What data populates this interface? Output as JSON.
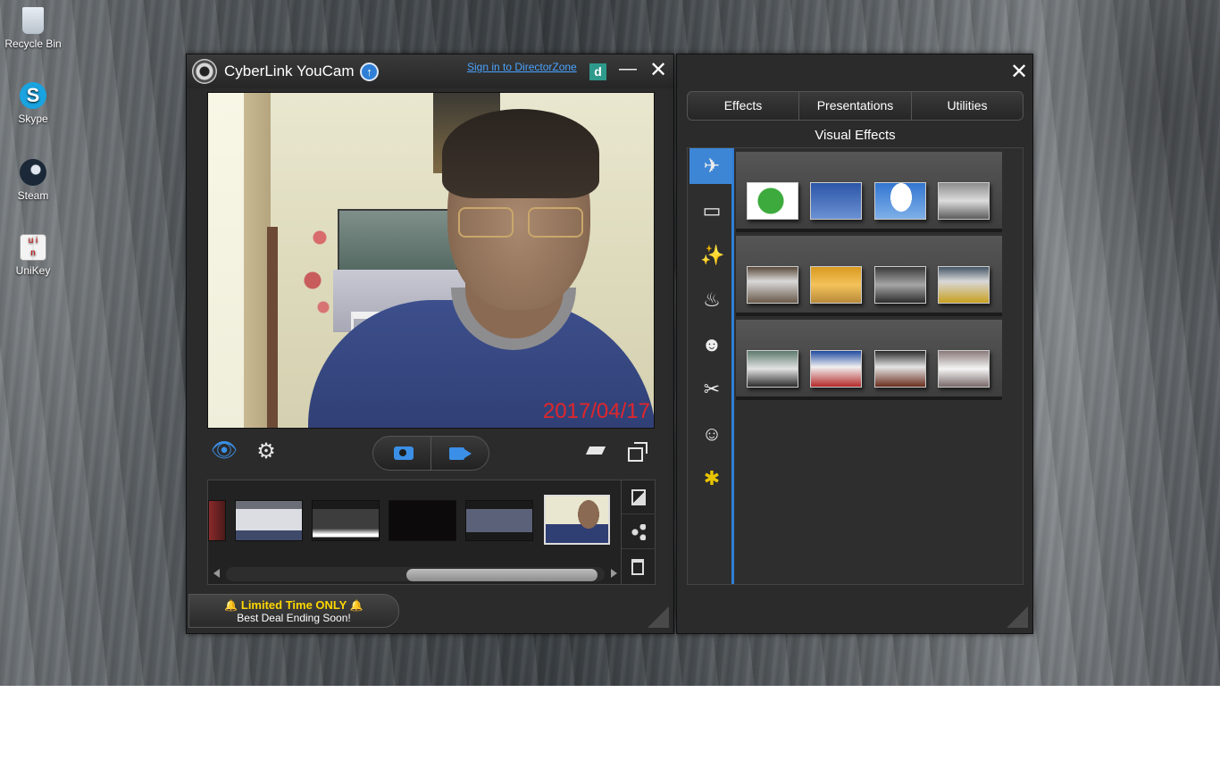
{
  "desktop": {
    "icons": [
      {
        "label": "Recycle Bin",
        "icon": "recycle-bin-icon"
      },
      {
        "label": "Skype",
        "icon": "skype-icon"
      },
      {
        "label": "Steam",
        "icon": "steam-icon"
      },
      {
        "label": "UniKey",
        "icon": "unikey-icon"
      }
    ]
  },
  "youcam": {
    "title": "CyberLink YouCam",
    "signin_link": "Sign in to DirectorZone",
    "directorzone_badge": "d",
    "minimize_glyph": "—",
    "close_glyph": "✕",
    "update_glyph": "↑",
    "video_timestamp": "2017/04/17",
    "eye_glyph": "👁",
    "gear_glyph": "⚙",
    "promo": {
      "line1": "Limited Time ONLY",
      "line2": "Best Deal Ending Soon!",
      "bell_glyph": "🔔"
    }
  },
  "effects_panel": {
    "close_glyph": "✕",
    "tabs": [
      "Effects",
      "Presentations",
      "Utilities"
    ],
    "heading": "Visual Effects",
    "category_glyphs": [
      "✈",
      "▭",
      "✨",
      "♨",
      "☻",
      "✂",
      "☺",
      "✱"
    ]
  },
  "colors": {
    "accent": "#2f7fd6",
    "timestamp": "#e2262a",
    "promo_highlight": "#ffd700",
    "link": "#4aa3ff"
  }
}
